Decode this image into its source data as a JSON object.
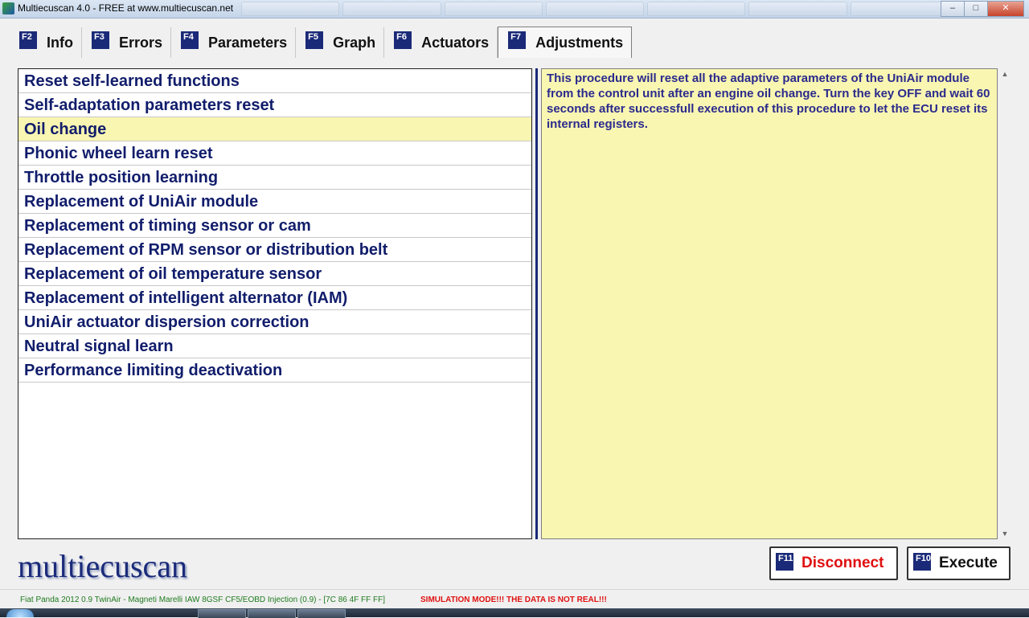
{
  "window": {
    "title": "Multiecuscan 4.0 - FREE at www.multiecuscan.net",
    "minimize": "–",
    "maximize": "□",
    "close": "✕"
  },
  "tabs": [
    {
      "key": "F2",
      "label": "Info"
    },
    {
      "key": "F3",
      "label": "Errors"
    },
    {
      "key": "F4",
      "label": "Parameters"
    },
    {
      "key": "F5",
      "label": "Graph"
    },
    {
      "key": "F6",
      "label": "Actuators"
    },
    {
      "key": "F7",
      "label": "Adjustments",
      "active": true
    }
  ],
  "procedures": [
    "Reset self-learned functions",
    "Self-adaptation parameters reset",
    "Oil change",
    "Phonic wheel learn reset",
    "Throttle position learning",
    "Replacement of UniAir module",
    "Replacement of timing sensor or cam",
    "Replacement of RPM sensor or distribution belt",
    "Replacement of oil temperature sensor",
    "Replacement of intelligent alternator (IAM)",
    "UniAir actuator dispersion correction",
    "Neutral signal learn",
    "Performance limiting deactivation"
  ],
  "selected_index": 2,
  "description": "This procedure will reset all the adaptive parameters of the UniAir module from the control unit after an engine oil change. Turn the key OFF and wait 60 seconds after successfull execution of this procedure to let the ECU reset its internal registers.",
  "logo": "multiecuscan",
  "buttons": {
    "disconnect": {
      "key": "F11",
      "label": "Disconnect"
    },
    "execute": {
      "key": "F10",
      "label": "Execute"
    }
  },
  "status": {
    "vehicle": "Fiat Panda 2012 0.9 TwinAir - Magneti Marelli IAW 8GSF CF5/EOBD Injection (0.9) - [7C 86 4F FF FF]",
    "warning": "SIMULATION MODE!!! THE DATA IS NOT REAL!!!"
  },
  "colors": {
    "accent": "#1a2a78",
    "selection": "#f9f6b2",
    "disconnect": "#e01010",
    "status_ok": "#1e7a1e"
  }
}
